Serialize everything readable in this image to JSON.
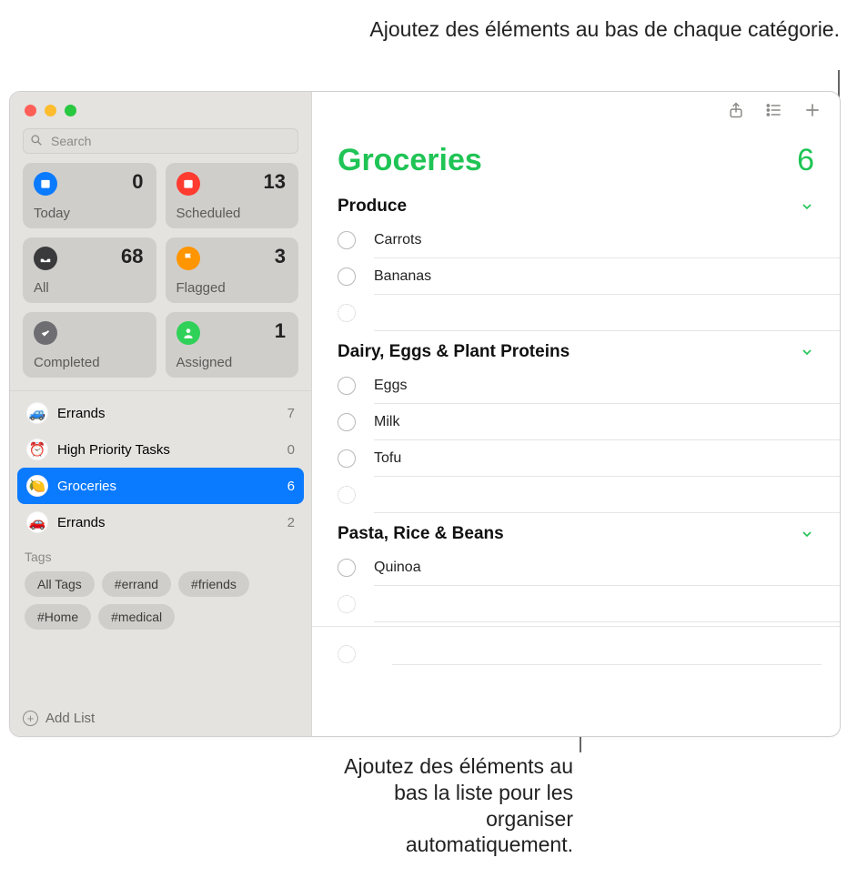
{
  "callouts": {
    "top": "Ajoutez des éléments au bas de chaque catégorie.",
    "bottom": "Ajoutez des éléments au bas la liste pour les organiser automatiquement."
  },
  "sidebar": {
    "search_placeholder": "Search",
    "smart": [
      {
        "label": "Today",
        "count": "0"
      },
      {
        "label": "Scheduled",
        "count": "13"
      },
      {
        "label": "All",
        "count": "68"
      },
      {
        "label": "Flagged",
        "count": "3"
      },
      {
        "label": "Completed",
        "count": ""
      },
      {
        "label": "Assigned",
        "count": "1"
      }
    ],
    "lists": [
      {
        "emoji": "🚙",
        "name": "Errands",
        "count": "7",
        "selected": false
      },
      {
        "emoji": "⏰",
        "name": "High Priority Tasks",
        "count": "0",
        "selected": false
      },
      {
        "emoji": "🍋",
        "name": "Groceries",
        "count": "6",
        "selected": true
      },
      {
        "emoji": "🚗",
        "name": "Errands",
        "count": "2",
        "selected": false
      }
    ],
    "tags_header": "Tags",
    "tags": [
      "All Tags",
      "#errand",
      "#friends",
      "#Home",
      "#medical"
    ],
    "add_list": "Add List"
  },
  "main": {
    "title": "Groceries",
    "count": "6",
    "sections": [
      {
        "name": "Produce",
        "items": [
          "Carrots",
          "Bananas"
        ]
      },
      {
        "name": "Dairy, Eggs & Plant Proteins",
        "items": [
          "Eggs",
          "Milk",
          "Tofu"
        ]
      },
      {
        "name": "Pasta, Rice & Beans",
        "items": [
          "Quinoa"
        ]
      }
    ]
  }
}
